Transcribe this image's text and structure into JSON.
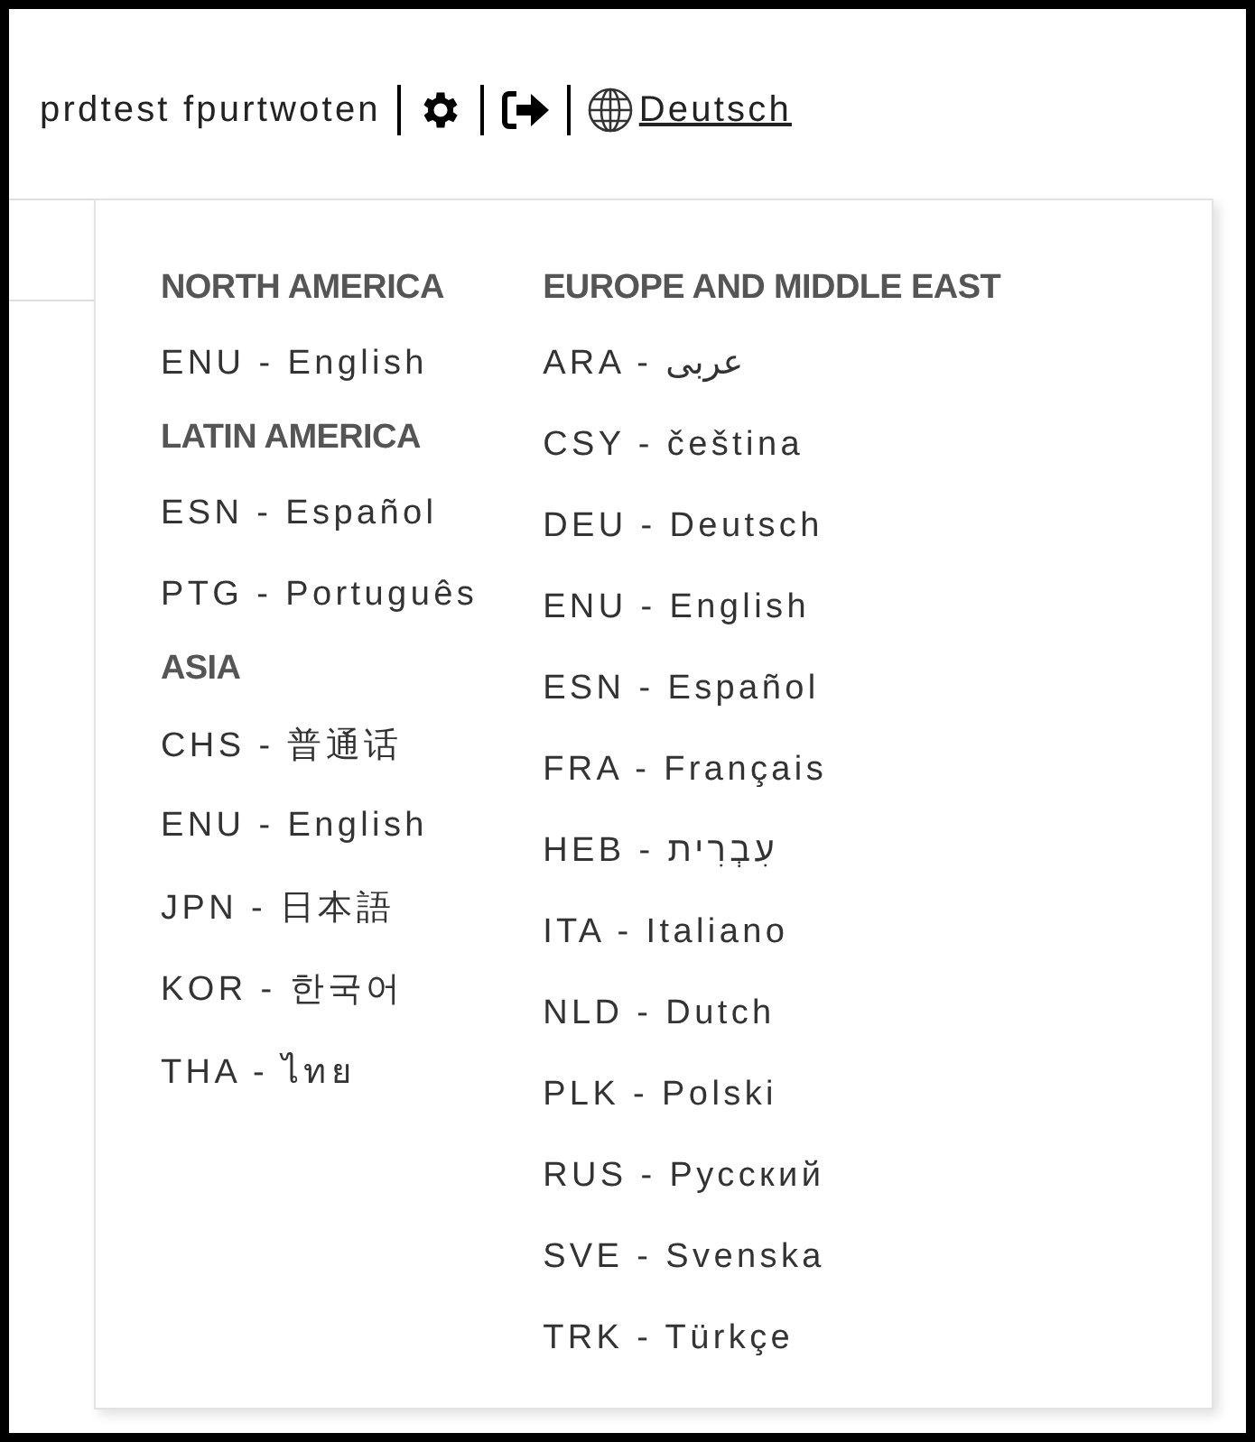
{
  "header": {
    "user": "prdtest fpurtwoten",
    "language": "Deutsch"
  },
  "columns": [
    {
      "groups": [
        {
          "heading": "NORTH AMERICA",
          "items": [
            "ENU - English"
          ]
        },
        {
          "heading": "LATIN AMERICA",
          "items": [
            "ESN - Español",
            "PTG - Português"
          ]
        },
        {
          "heading": "ASIA",
          "items": [
            "CHS - 普通话",
            "ENU - English",
            "JPN - 日本語",
            "KOR - 한국어",
            "THA - ไทย"
          ]
        }
      ]
    },
    {
      "groups": [
        {
          "heading": "EUROPE AND MIDDLE EAST",
          "items": [
            "ARA - عربى",
            "CSY - čeština",
            "DEU - Deutsch",
            "ENU - English",
            "ESN - Español",
            "FRA - Français",
            "HEB - עִבְרִית",
            "ITA - Italiano",
            "NLD - Dutch",
            "PLK - Polski",
            "RUS - Русский",
            "SVE - Svenska",
            "TRK - Türkçe"
          ]
        }
      ]
    }
  ]
}
